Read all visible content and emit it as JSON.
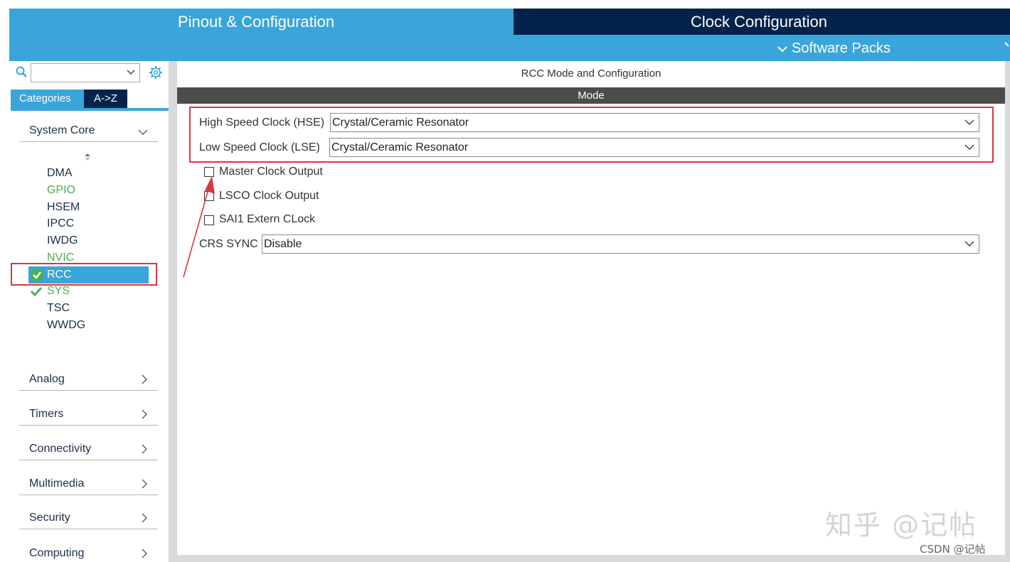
{
  "header": {
    "tab_pinout": "Pinout & Configuration",
    "tab_clock": "Clock Configuration",
    "software_packs": "Software Packs"
  },
  "sidebar": {
    "search": {
      "value": ""
    },
    "tabs": {
      "categories": "Categories",
      "az": "A->Z"
    },
    "system_core": {
      "label": "System Core",
      "items": [
        "DMA",
        "GPIO",
        "HSEM",
        "IPCC",
        "IWDG",
        "NVIC",
        "RCC",
        "SYS",
        "TSC",
        "WWDG"
      ]
    },
    "groups": [
      "Analog",
      "Timers",
      "Connectivity",
      "Multimedia",
      "Security",
      "Computing"
    ]
  },
  "main": {
    "title": "RCC Mode and Configuration",
    "mode_bar": "Mode",
    "hse": {
      "label": "High Speed Clock (HSE)",
      "value": "Crystal/Ceramic Resonator"
    },
    "lse": {
      "label": "Low Speed Clock (LSE)",
      "value": "Crystal/Ceramic Resonator"
    },
    "checkboxes": [
      "Master Clock Output",
      "LSCO Clock Output",
      "SAI1 Extern CLock"
    ],
    "crs": {
      "label": "CRS SYNC",
      "value": "Disable"
    }
  },
  "watermarks": {
    "zhihu": "知乎 @记帖",
    "csdn": "CSDN @记帖"
  },
  "colors": {
    "accent": "#39a5da",
    "navy": "#03234b",
    "highlight_red": "#d9373b",
    "enabled_green": "#4caf50"
  }
}
